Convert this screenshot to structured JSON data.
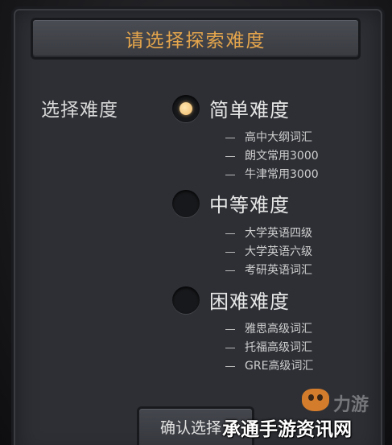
{
  "dialog": {
    "title": "请选择探索难度",
    "field_label": "选择难度",
    "confirm_label": "确认选择"
  },
  "options": [
    {
      "title": "简单难度",
      "selected": true,
      "items": [
        "高中大纲词汇",
        "朗文常用3000",
        "牛津常用3000"
      ]
    },
    {
      "title": "中等难度",
      "selected": false,
      "items": [
        "大学英语四级",
        "大学英语六级",
        "考研英语词汇"
      ]
    },
    {
      "title": "困难难度",
      "selected": false,
      "items": [
        "雅思高级词汇",
        "托福高级词汇",
        "GRE高级词汇"
      ]
    }
  ],
  "watermark": {
    "text": "承通手游资讯网",
    "mark": "力游"
  },
  "colors": {
    "accent": "#e4a54c",
    "panel": "#2d2f35",
    "radio_dot": "#f0bb6a"
  }
}
